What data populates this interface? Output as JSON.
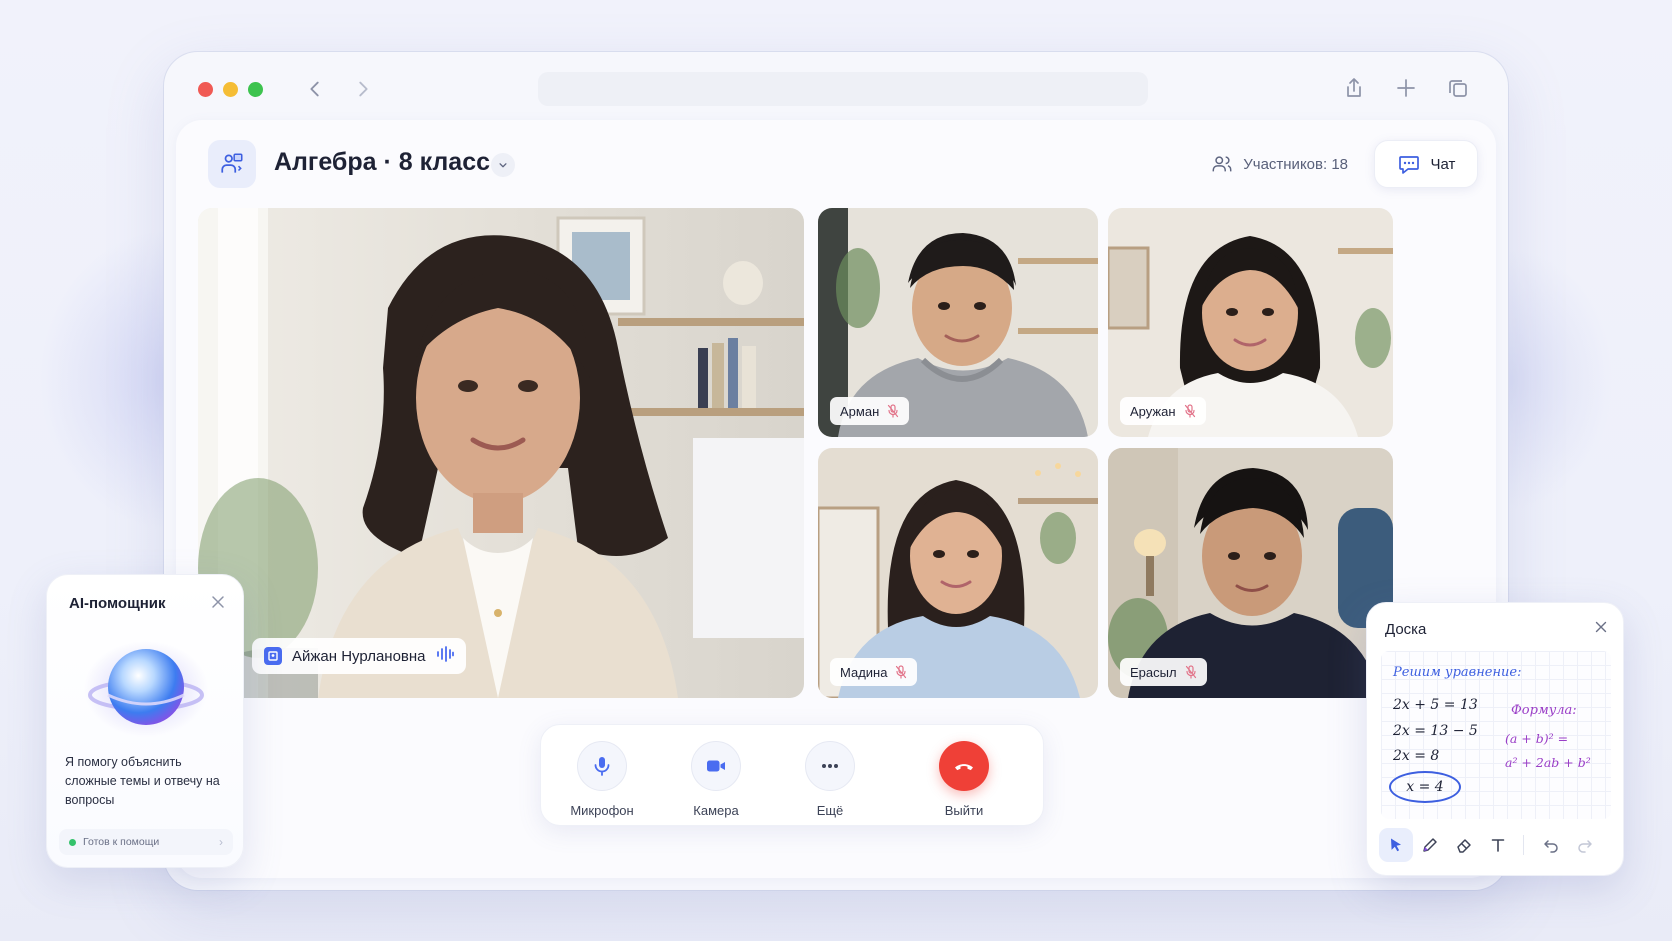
{
  "header": {
    "class_title": "Алгебра · 8 класс",
    "participants_label": "Участников: 18",
    "chat_label": "Чат"
  },
  "video": {
    "teacher": {
      "name": "Айжан Нурлановна",
      "speaking": true
    },
    "students": [
      {
        "name": "Арман",
        "muted": true
      },
      {
        "name": "Аружан",
        "muted": true
      },
      {
        "name": "Мадина",
        "muted": true
      },
      {
        "name": "Ерасыл",
        "muted": true
      }
    ]
  },
  "controls": {
    "microphone": "Микрофон",
    "camera": "Камера",
    "more": "Ещё",
    "leave": "Выйти"
  },
  "ai_assistant": {
    "title": "AI-помощник",
    "message": "Я помогу объяснить сложные темы и отвечу на вопросы",
    "status": "Готов к помощи"
  },
  "whiteboard": {
    "title": "Доска",
    "heading": "Решим уравнение:",
    "lines": [
      "2x + 5 = 13",
      "2x = 13 − 5",
      "2x = 8"
    ],
    "answer": "x = 4",
    "formula_title": "Формула:",
    "formula_line1": "(a + b)² =",
    "formula_line2": "a² + 2ab + b²"
  },
  "colors": {
    "accent": "#4a6cf0",
    "end_call": "#ef4037",
    "status_ok": "#34c26b",
    "formula": "#9a3ec7"
  }
}
